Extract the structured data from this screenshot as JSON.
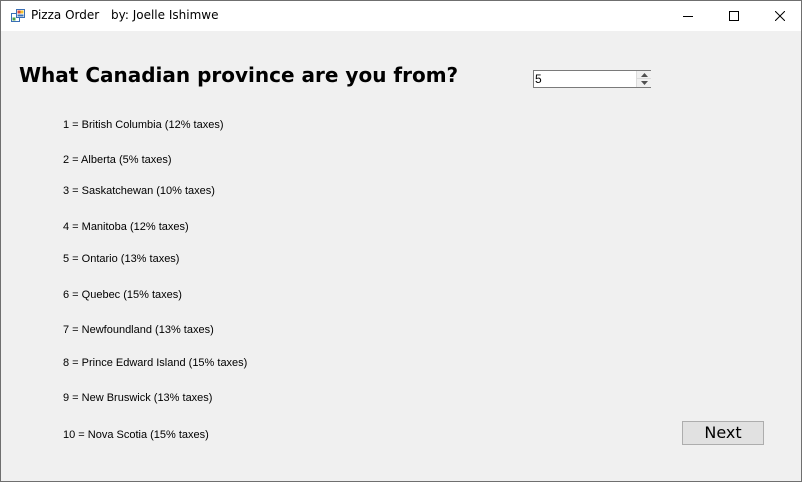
{
  "window": {
    "app_title": "Pizza Order",
    "author_label": "by: Joelle Ishimwe"
  },
  "form": {
    "question": "What Canadian province are you from?",
    "province_value": "5",
    "provinces": [
      "1 = British Columbia (12% taxes)",
      "2 = Alberta (5% taxes)",
      "3 = Saskatchewan (10% taxes)",
      "4 = Manitoba (12% taxes)",
      "5 = Ontario (13% taxes)",
      "6 = Quebec (15% taxes)",
      "7 = Newfoundland (13% taxes)",
      "8 = Prince Edward Island (15% taxes)",
      "9 = New Bruswick (13% taxes)",
      "10 = Nova Scotia (15% taxes)"
    ],
    "next_label": "Next"
  }
}
